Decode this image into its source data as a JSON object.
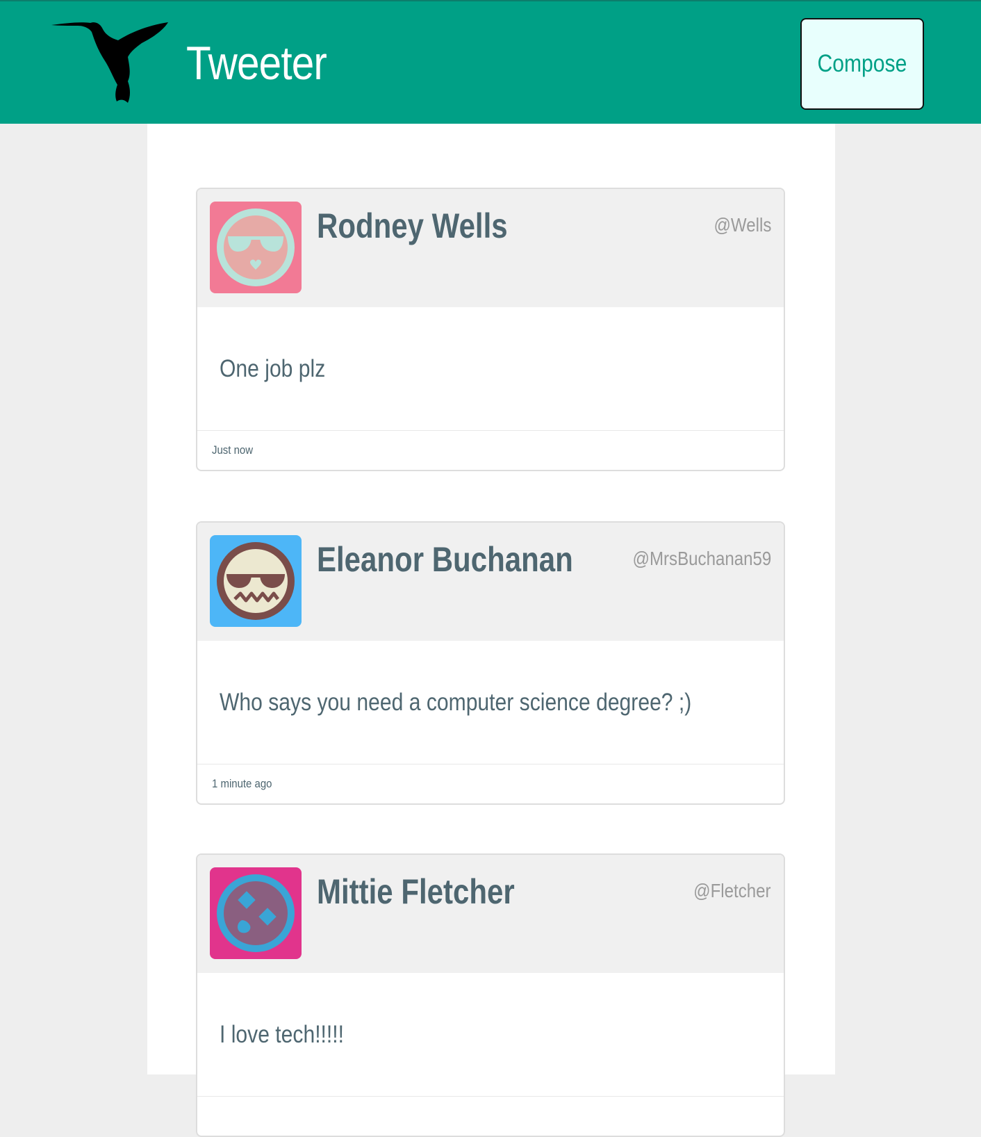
{
  "header": {
    "brand": "Tweeter",
    "logo_icon": "hummingbird-icon",
    "compose_label": "Compose",
    "background_color": "#00a086"
  },
  "tweets": [
    {
      "name": "Rodney Wells",
      "handle": "@Wells",
      "text": "One job plz",
      "time": "Just now",
      "avatar": {
        "icon": "sunglasses-face-icon",
        "background": "#f27a95"
      }
    },
    {
      "name": "Eleanor Buchanan",
      "handle": "@MrsBuchanan59",
      "text": "Who says you need a computer science degree? ;)",
      "time": "1 minute ago",
      "avatar": {
        "icon": "cool-grimace-face-icon",
        "background": "#4db6f7"
      }
    },
    {
      "name": "Mittie Fletcher",
      "handle": "@Fletcher",
      "text": "I love tech!!!!!",
      "time": "",
      "avatar": {
        "icon": "diamond-eyes-face-icon",
        "background": "#e1348c"
      }
    }
  ]
}
